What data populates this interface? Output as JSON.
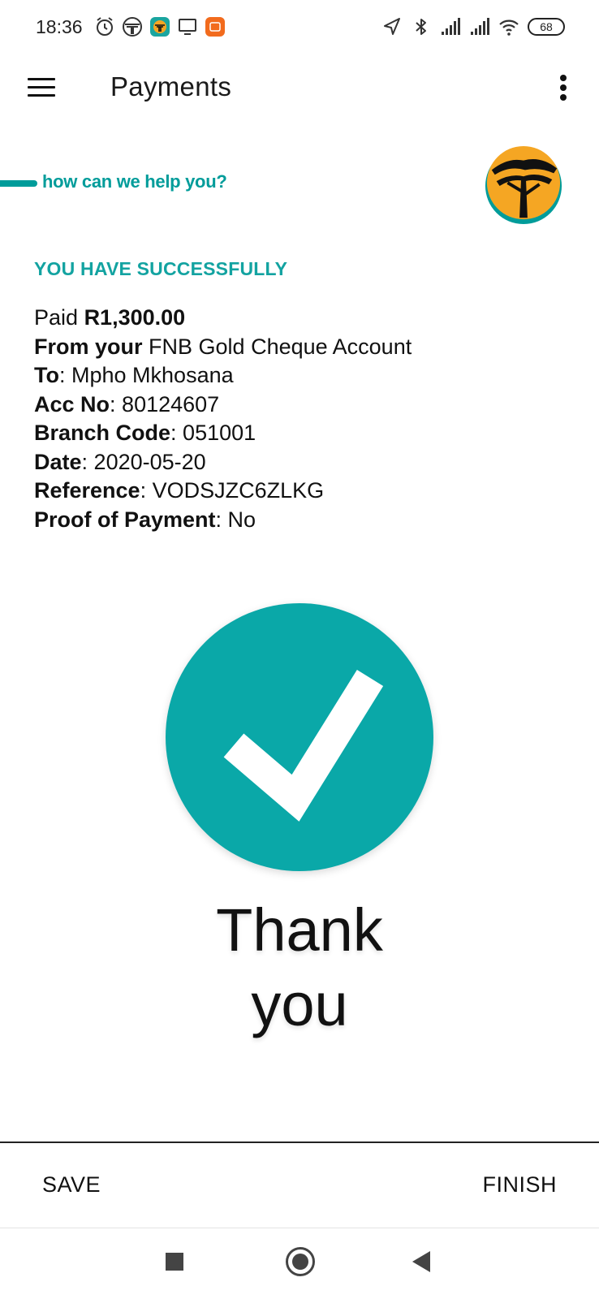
{
  "status_bar": {
    "time": "18:36",
    "battery": "68",
    "left_icons": [
      "alarm-icon",
      "fnb-tree-icon",
      "fnb-app-icon",
      "screen-cast-icon",
      "mi-app-icon"
    ],
    "right_icons": [
      "location-arrow-icon",
      "bluetooth-icon",
      "signal-1-icon",
      "signal-2-icon",
      "wifi-icon",
      "battery-icon"
    ]
  },
  "app_bar": {
    "title": "Payments",
    "menu_icon": "hamburger-menu-icon",
    "overflow_icon": "more-vert-icon"
  },
  "banner": {
    "tagline": "how can we help you?",
    "logo_icon": "fnb-tree-logo",
    "accent_color": "#009c9a",
    "logo_color": "#f5a623"
  },
  "confirmation": {
    "heading": "YOU HAVE SUCCESSFULLY",
    "paid_label": "Paid",
    "paid_amount": "R1,300.00",
    "from_label": "From your",
    "from_value": "FNB Gold Cheque Account",
    "to_label": "To",
    "to_value": "Mpho Mkhosana",
    "acc_label": "Acc No",
    "acc_value": "80124607",
    "branch_label": "Branch Code",
    "branch_value": "051001",
    "date_label": "Date",
    "date_value": "2020-05-20",
    "reference_label": "Reference",
    "reference_value": "VODSJZC6ZLKG",
    "pop_label": "Proof of Payment",
    "pop_value": "No"
  },
  "success": {
    "icon": "checkmark-icon",
    "circle_color": "#0aa8a8",
    "thank_line1": "Thank",
    "thank_line2": "you"
  },
  "actions": {
    "save_label": "SAVE",
    "finish_label": "FINISH"
  },
  "nav": {
    "recents_icon": "recents-square-icon",
    "home_icon": "home-circle-icon",
    "back_icon": "back-triangle-icon"
  }
}
